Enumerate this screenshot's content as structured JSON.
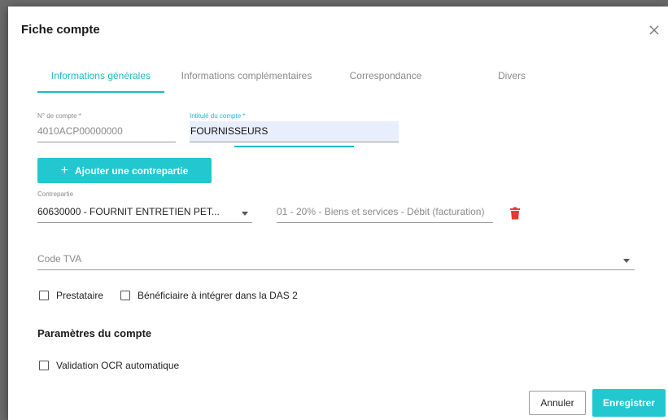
{
  "dialog": {
    "title": "Fiche compte"
  },
  "tabs": [
    {
      "label": "Informations générales",
      "active": true
    },
    {
      "label": "Informations complémentaires",
      "active": false
    },
    {
      "label": "Correspondance",
      "active": false
    },
    {
      "label": "Divers",
      "active": false
    }
  ],
  "account": {
    "number_label": "N° de compte *",
    "number_value": "4010ACP00000000",
    "title_label": "Intitulé du compte *",
    "title_value": "FOURNISSEURS"
  },
  "add_counterpart_label": "Ajouter une contrepartie",
  "counterpart": {
    "label": "Contrepartie",
    "value": "60630000  -  FOURNIT ENTRETIEN PET...",
    "vat_value": "01 - 20% - Biens et services - Débit (facturation)"
  },
  "code_tva": {
    "placeholder": "Code TVA"
  },
  "checkboxes": {
    "prestataire": "Prestataire",
    "beneficiaire": "Bénéficiaire à intégrer dans la DAS 2",
    "validation_ocr": "Validation OCR automatique"
  },
  "section_title": "Paramètres du compte",
  "buttons": {
    "cancel": "Annuler",
    "save": "Enregistrer"
  },
  "colors": {
    "accent": "#22c7cf",
    "delete": "#e53935"
  }
}
